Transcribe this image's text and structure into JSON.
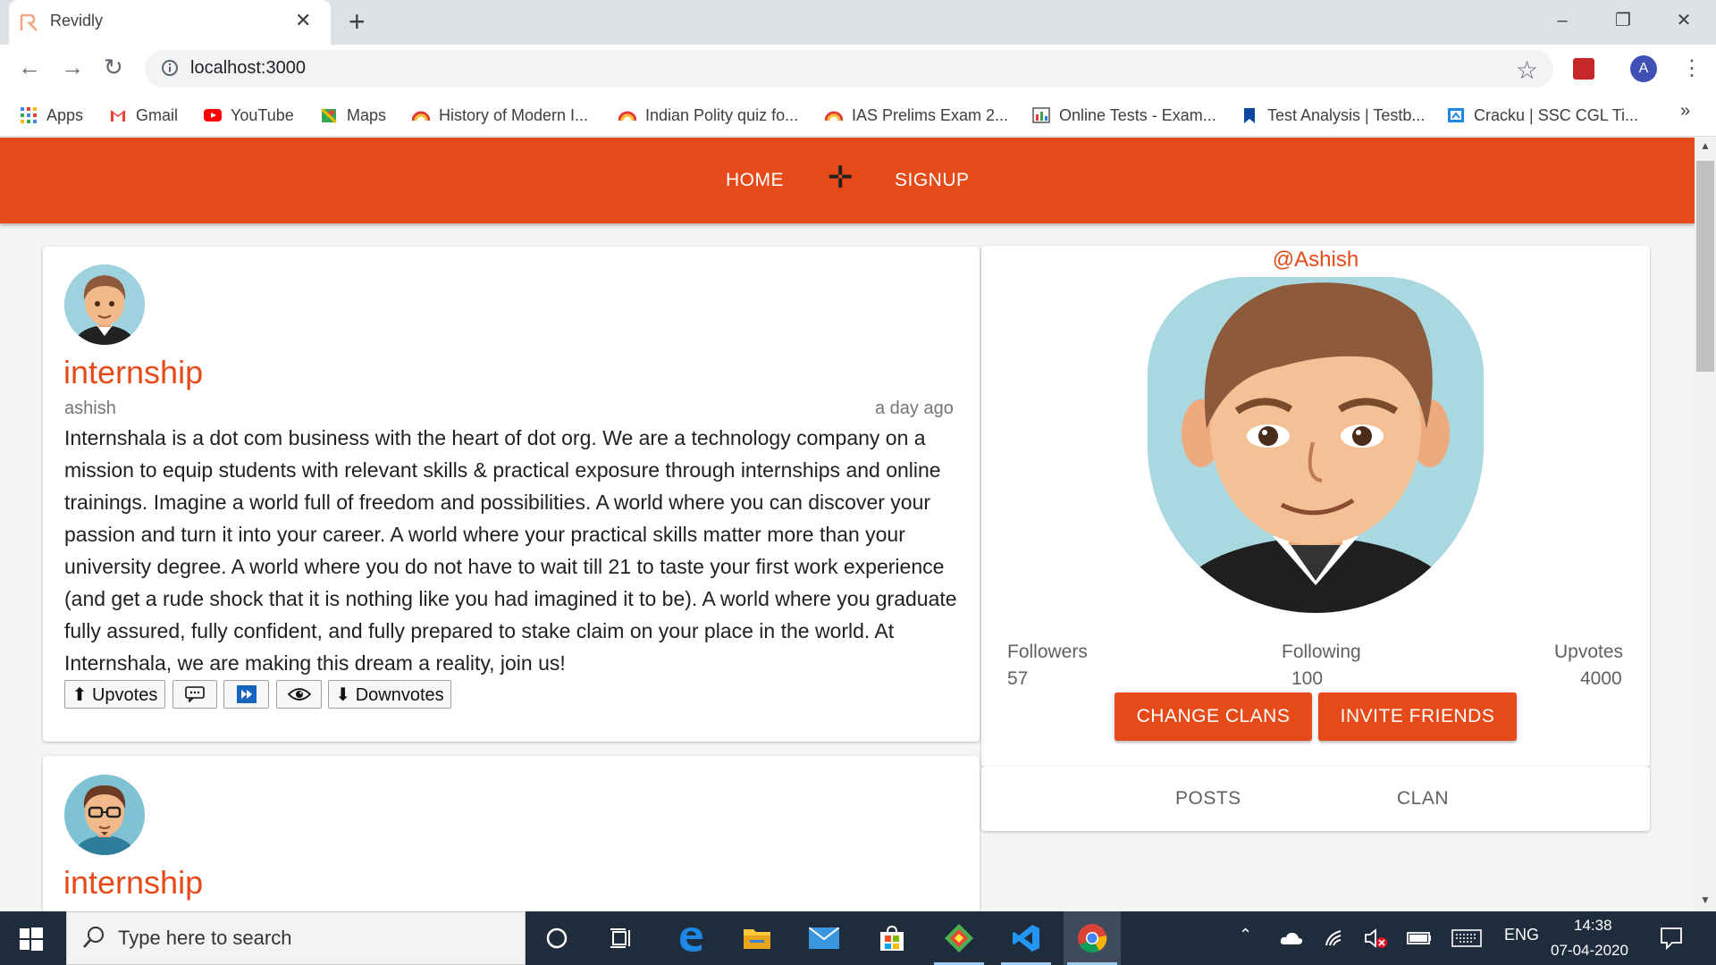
{
  "browser": {
    "tab_title": "Revidly",
    "tab_close": "✕",
    "new_tab": "+",
    "url": "localhost:3000",
    "window_controls": [
      "–",
      "❐",
      "✕"
    ],
    "profile_initial": "A",
    "bookmarks_more": "»",
    "bookmarks": [
      {
        "label": "Apps",
        "icon": "apps-grid-icon"
      },
      {
        "label": "Gmail",
        "icon": "gmail-icon"
      },
      {
        "label": "YouTube",
        "icon": "youtube-icon"
      },
      {
        "label": "Maps",
        "icon": "maps-icon"
      },
      {
        "label": "History of Modern I...",
        "icon": "rainbow-icon"
      },
      {
        "label": "Indian Polity quiz fo...",
        "icon": "rainbow-icon"
      },
      {
        "label": "IAS Prelims Exam 2...",
        "icon": "rainbow-icon"
      },
      {
        "label": "Online Tests - Exam...",
        "icon": "chart-icon"
      },
      {
        "label": "Test Analysis | Testb...",
        "icon": "bookmark-icon"
      },
      {
        "label": "Cracku | SSC CGL Ti...",
        "icon": "cracku-icon"
      }
    ]
  },
  "app": {
    "accent": "#e64a19",
    "nav": {
      "home": "HOME",
      "signup": "SIGNUP"
    }
  },
  "posts": [
    {
      "title": "internship",
      "author": "ashish",
      "time": "a day ago",
      "body": "Internshala is a dot com business with the heart of dot org. We are a technology company on a mission to equip students with relevant skills & practical exposure through internships and online trainings. Imagine a world full of freedom and possibilities. A world where you can discover your passion and turn it into your career. A world where your practical skills matter more than your university degree. A world where you do not have to wait till 21 to taste your first work experience (and get a rude shock that it is nothing like you had imagined it to be). A world where you graduate fully assured, fully confident, and fully prepared to stake claim on your place in the world. At Internshala, we are making this dream a reality, join us!",
      "upvotes_label": "⬆ Upvotes",
      "downvotes_label": "⬇ Downvotes"
    },
    {
      "title": "internship"
    }
  ],
  "profile": {
    "handle": "@Ashish",
    "followers_label": "Followers",
    "followers": "57",
    "following_label": "Following",
    "following": "100",
    "upvotes_label": "Upvotes",
    "upvotes": "4000",
    "change_clans": "CHANGE CLANS",
    "invite_friends": "INVITE FRIENDS",
    "tabs": [
      "POSTS",
      "CLAN"
    ]
  },
  "taskbar": {
    "search_placeholder": "Type here to search",
    "language": "ENG",
    "time": "14:38",
    "date": "07-04-2020"
  }
}
